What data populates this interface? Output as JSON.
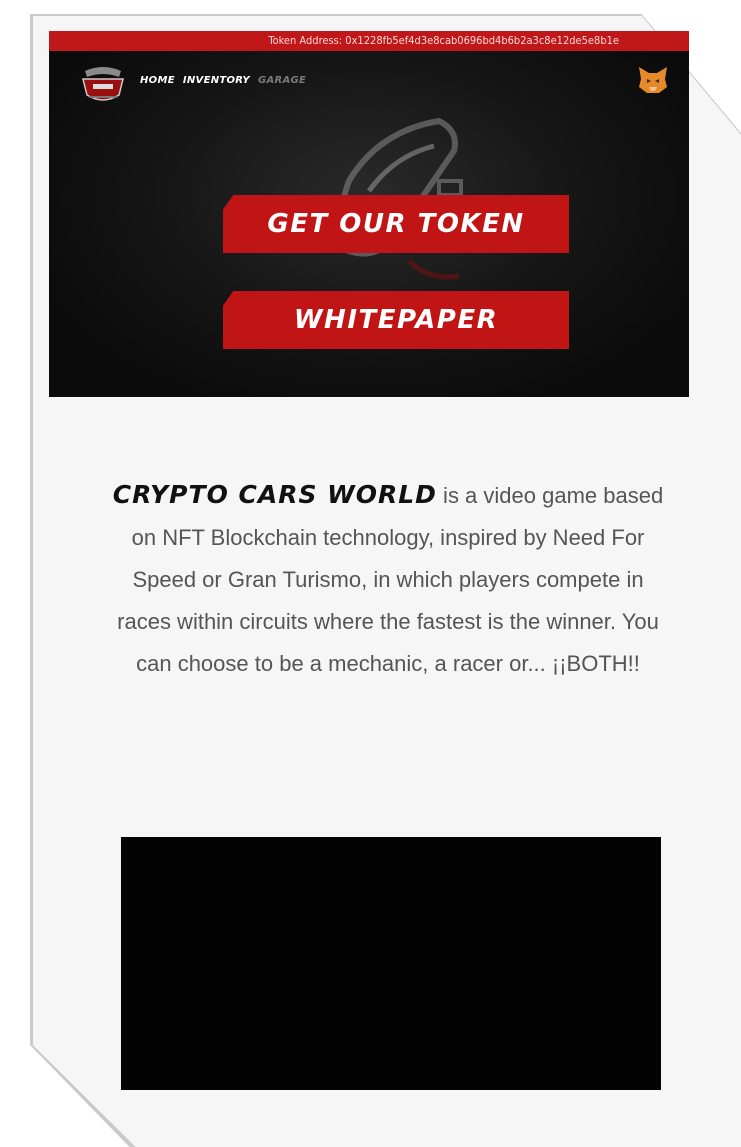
{
  "token_address": "Token Address: 0x1228fb5ef4d3e8cab0696bd4b6b2a3c8e12de5e8b1e",
  "nav": {
    "links": [
      "HOME",
      "INVENTORY",
      "GARAGE"
    ]
  },
  "hero": {
    "buttons": {
      "token": "GET OUR TOKEN",
      "whitepaper": "WHITEPAPER"
    }
  },
  "description": {
    "brand": "CRYPTO CARS WORLD",
    "text": " is a video game based on NFT Blockchain technology, inspired by Need For Speed or Gran Turismo, in which players compete in races within circuits where the fastest is the winner. You can choose to be a mechanic, a racer or... ¡¡BOTH!!"
  },
  "icons": {
    "logo": "crypto-cars-world-logo",
    "wallet": "metamask-fox-icon"
  },
  "colors": {
    "accent": "#c11414",
    "hero_bg": "#0d0d0d",
    "text": "#555555"
  }
}
